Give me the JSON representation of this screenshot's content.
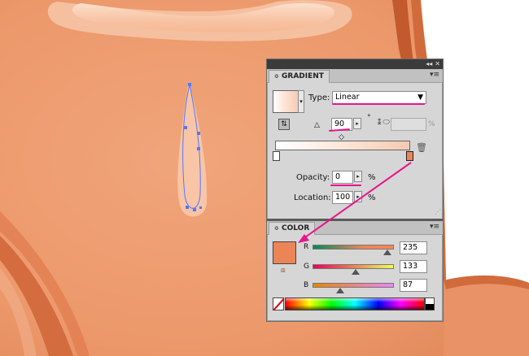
{
  "gradient_panel": {
    "title": "GRADIENT",
    "type_label": "Type:",
    "type_value": "Linear",
    "angle_value": "90",
    "degree_symbol": "°",
    "percent_suffix": "%",
    "opacity_label": "Opacity:",
    "opacity_value": "0",
    "opacity_unit": "%",
    "location_label": "Location:",
    "location_value": "100",
    "location_unit": "%"
  },
  "color_panel": {
    "title": "COLOR",
    "channels": [
      {
        "label": "R",
        "value": "235"
      },
      {
        "label": "G",
        "value": "133"
      },
      {
        "label": "B",
        "value": "87"
      }
    ],
    "fill_color": "#eb8557"
  },
  "colors": {
    "skin": "#eb9e72",
    "annotation": "#e6168c",
    "path_blue": "#5577ff"
  }
}
